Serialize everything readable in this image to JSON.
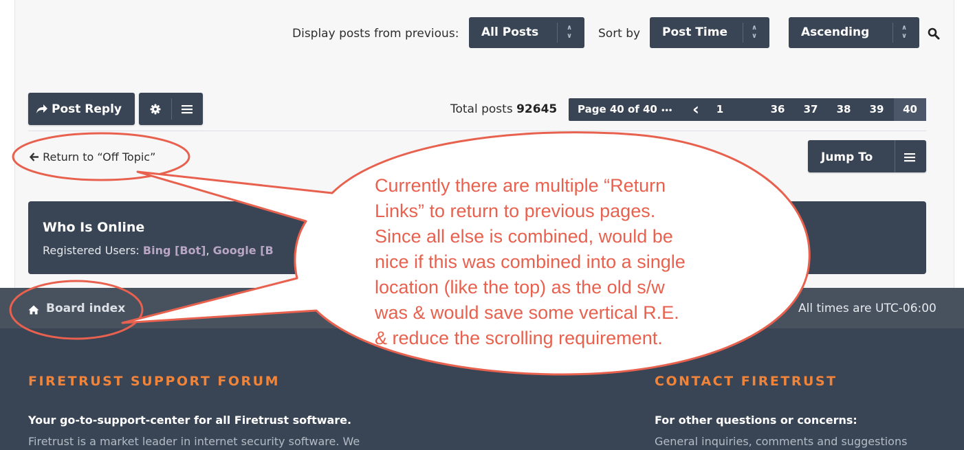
{
  "filters": {
    "display_label": "Display posts from previous:",
    "display_value": "All Posts",
    "sort_label": "Sort by",
    "sort_value": "Post Time",
    "order_value": "Ascending",
    "arrow_up": "∧",
    "arrow_down": "∨"
  },
  "toolbar": {
    "post_reply_label": "Post Reply",
    "total_posts_label": "Total posts",
    "total_posts_value": "92645"
  },
  "pagination": {
    "page_info": "Page 40 of 40",
    "ellipsis": "•••",
    "prev": "‹",
    "pages": [
      "1",
      "36",
      "37",
      "38",
      "39",
      "40"
    ],
    "current": "40"
  },
  "return_link": "Return to “Off Topic”",
  "jump_to_label": "Jump To",
  "who_is_online": {
    "title": "Who Is Online",
    "registered_label": "Registered Users:",
    "users": [
      "Bing [Bot]",
      "Google [B"
    ],
    "separator": ","
  },
  "footer_nav": {
    "board_index": "Board index",
    "timezone": "All times are UTC-06:00"
  },
  "footer": {
    "left_heading": "FIRETRUST SUPPORT FORUM",
    "left_subheading": "Your go-to-support-center for all Firetrust software.",
    "left_text": "Firetrust is a market leader in internet security software. We",
    "right_heading": "CONTACT FIRETRUST",
    "right_subheading": "For other questions or concerns:",
    "right_text": "General inquiries, comments and suggestions"
  },
  "annotation": {
    "lines": [
      "Currently there are multiple “Return",
      "Links” to return to previous pages.",
      "Since all else is combined, would be",
      "nice if this was combined into a single",
      "location (like the top) as the old s/w",
      "was & would save some vertical R.E.",
      "& reduce the scrolling requirement."
    ],
    "color": "#e8614e"
  },
  "colors": {
    "button_dark": "#394555",
    "footer_nav": "#48525f",
    "accent_orange": "#f1843b",
    "user_link": "#b9a6c6"
  }
}
